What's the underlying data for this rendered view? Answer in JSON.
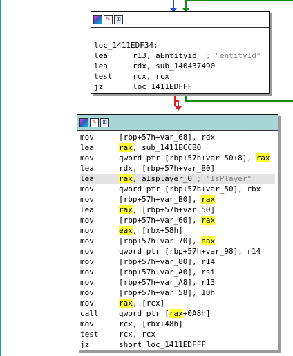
{
  "graph": {
    "top_node": {
      "label": "loc_1411EDF34:",
      "lines": [
        {
          "op": "lea",
          "segments": [
            {
              "t": "r13, aEntityid"
            },
            {
              "t": "  ; \"entityId\"",
              "c": true
            }
          ]
        },
        {
          "op": "lea",
          "segments": [
            {
              "t": "rdx, sub_140437490"
            }
          ]
        },
        {
          "op": "test",
          "segments": [
            {
              "t": "rcx, rcx"
            }
          ]
        },
        {
          "op": "jz",
          "segments": [
            {
              "t": "loc_1411EDFFF"
            }
          ]
        }
      ]
    },
    "main_node": {
      "lines": [
        {
          "op": "mov",
          "segments": [
            {
              "t": "[rbp+57h+var_68], rdx"
            }
          ]
        },
        {
          "op": "lea",
          "segments": [
            {
              "t": "rax",
              "h": true
            },
            {
              "t": ", sub_1411ECCB0"
            }
          ]
        },
        {
          "op": "mov",
          "segments": [
            {
              "t": "qword ptr [rbp+57h+var_50+8], "
            },
            {
              "t": "rax",
              "h": true
            }
          ]
        },
        {
          "op": "lea",
          "segments": [
            {
              "t": "rdx, [rbp+57h+var_B0]"
            }
          ]
        },
        {
          "op": "lea",
          "sel": true,
          "segments": [
            {
              "t": "rax",
              "h": true
            },
            {
              "t": ", aIsplayer_0"
            },
            {
              "t": " ; \"IsPlayer\"",
              "c": true
            }
          ]
        },
        {
          "op": "mov",
          "segments": [
            {
              "t": "qword ptr [rbp+57h+var_50], rbx"
            }
          ]
        },
        {
          "op": "mov",
          "segments": [
            {
              "t": "[rbp+57h+var_B0], "
            },
            {
              "t": "rax",
              "h": true
            }
          ]
        },
        {
          "op": "lea",
          "segments": [
            {
              "t": "rax",
              "h": true
            },
            {
              "t": ", [rbp+57h+var_50]"
            }
          ]
        },
        {
          "op": "mov",
          "segments": [
            {
              "t": "[rbp+57h+var_60], "
            },
            {
              "t": "rax",
              "h": true
            }
          ]
        },
        {
          "op": "mov",
          "segments": [
            {
              "t": "eax",
              "h": true
            },
            {
              "t": ", [rbx+58h]"
            }
          ]
        },
        {
          "op": "mov",
          "segments": [
            {
              "t": "[rbp+57h+var_70], "
            },
            {
              "t": "eax",
              "h": true
            }
          ]
        },
        {
          "op": "mov",
          "segments": [
            {
              "t": "qword ptr [rbp+57h+var_98], r14"
            }
          ]
        },
        {
          "op": "mov",
          "segments": [
            {
              "t": "[rbp+57h+var_80], r14"
            }
          ]
        },
        {
          "op": "mov",
          "segments": [
            {
              "t": "[rbp+57h+var_A0], rsi"
            }
          ]
        },
        {
          "op": "mov",
          "segments": [
            {
              "t": "[rbp+57h+var_A8], r13"
            }
          ]
        },
        {
          "op": "mov",
          "segments": [
            {
              "t": "[rbp+57h+var_58], 10h"
            }
          ]
        },
        {
          "op": "mov",
          "segments": [
            {
              "t": "rax",
              "h": true
            },
            {
              "t": ", [rcx]"
            }
          ]
        },
        {
          "op": "call",
          "segments": [
            {
              "t": "qword ptr ["
            },
            {
              "t": "rax",
              "h": true
            },
            {
              "t": "+0A8h]"
            }
          ]
        },
        {
          "op": "mov",
          "segments": [
            {
              "t": "rcx, [rbx+48h]"
            }
          ]
        },
        {
          "op": "test",
          "segments": [
            {
              "t": "rcx, rcx"
            }
          ]
        },
        {
          "op": "jz",
          "segments": [
            {
              "t": "short loc_1411EDFFF"
            }
          ]
        }
      ]
    },
    "colors": {
      "header_bg_top": "#ffffff",
      "header_bg_main": "#a8d6d6",
      "highlight": "#ffff33",
      "comment": "#808080",
      "edge_true": "#1a8a1a",
      "edge_false": "#e02020",
      "edge_unconditional": "#2050e0",
      "edge_side": "#20a0a0"
    }
  }
}
